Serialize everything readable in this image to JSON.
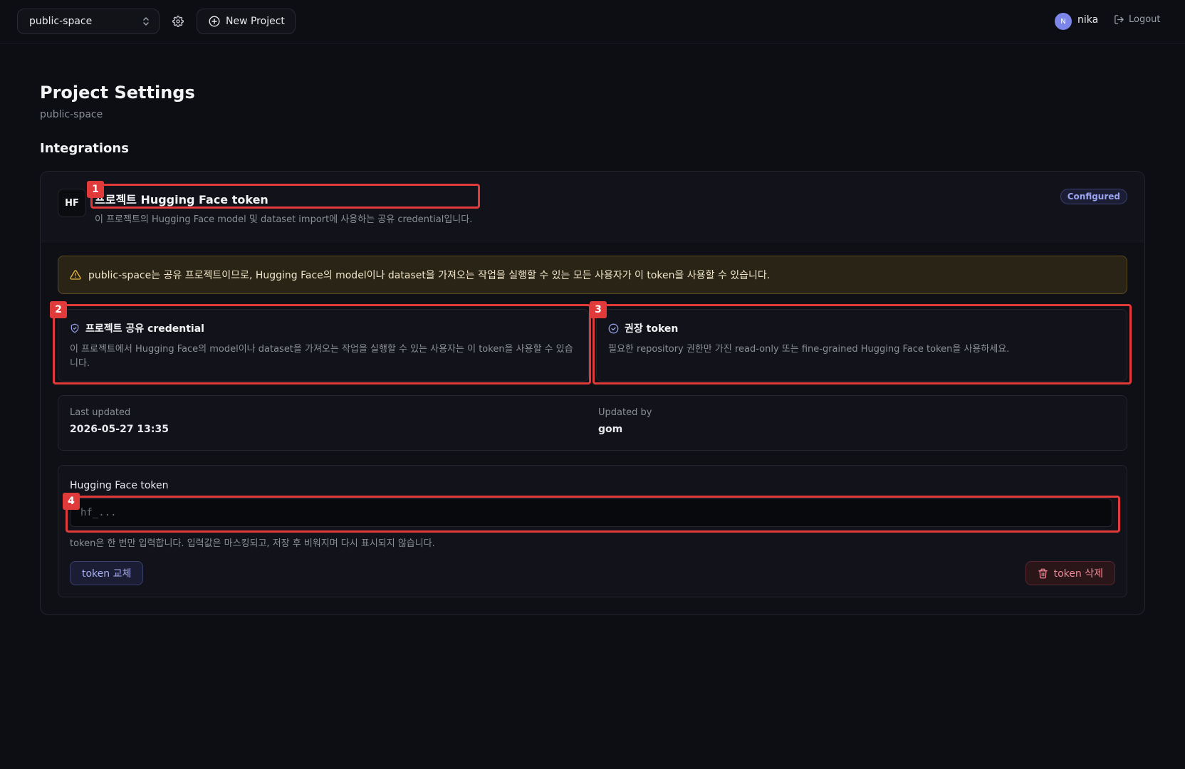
{
  "topbar": {
    "project_select": "public-space",
    "new_project_label": "New Project",
    "avatar_initial": "N",
    "username": "nika",
    "logout_label": "Logout"
  },
  "page": {
    "title": "Project Settings",
    "subtitle": "public-space",
    "section_title": "Integrations"
  },
  "integration": {
    "badge": "HF",
    "title": "프로젝트 Hugging Face token",
    "description": "이 프로젝트의 Hugging Face model 및 dataset import에 사용하는 공유 credential입니다.",
    "status": "Configured",
    "warning": "public-space는 공유 프로젝트이므로, Hugging Face의 model이나 dataset을 가져오는 작업을 실행할 수 있는 모든 사용자가 이 token을 사용할 수 있습니다.",
    "shared_box": {
      "title": "프로젝트 공유 credential",
      "body": "이 프로젝트에서 Hugging Face의 model이나 dataset을 가져오는 작업을 실행할 수 있는 사용자는 이 token을 사용할 수 있습니다."
    },
    "recommended_box": {
      "title": "권장 token",
      "body": "필요한 repository 권한만 가진 read-only 또는 fine-grained Hugging Face token을 사용하세요."
    },
    "meta": {
      "last_updated_label": "Last updated",
      "last_updated_value": "2026-05-27 13:35",
      "updated_by_label": "Updated by",
      "updated_by_value": "gom"
    },
    "token": {
      "label": "Hugging Face token",
      "placeholder": "hf_...",
      "hint": "token은 한 번만 입력합니다. 입력값은 마스킹되고, 저장 후 비워지며 다시 표시되지 않습니다.",
      "replace_label": "token 교체",
      "delete_label": "token 삭제"
    }
  },
  "annotations": [
    "1",
    "2",
    "3",
    "4"
  ],
  "colors": {
    "background": "#0d0e13",
    "accent": "#9aa4ef",
    "warning": "#e8b73f",
    "danger": "#f08a96",
    "annotation": "#e03a3a"
  }
}
